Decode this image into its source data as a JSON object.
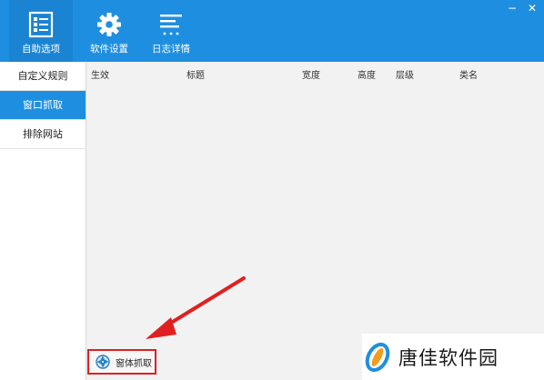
{
  "window": {
    "minimize_glyph": "−",
    "close_glyph": "✕"
  },
  "toolbar": {
    "items": [
      {
        "label": "自助选项",
        "icon": "checklist-icon",
        "active": true
      },
      {
        "label": "软件设置",
        "icon": "gear-icon",
        "active": false
      },
      {
        "label": "日志详情",
        "icon": "log-lines-icon",
        "active": false
      }
    ]
  },
  "sidebar": {
    "items": [
      {
        "label": "自定义规则",
        "active": false
      },
      {
        "label": "窗口抓取",
        "active": true
      },
      {
        "label": "排除网站",
        "active": false
      }
    ]
  },
  "table": {
    "columns": [
      "生效",
      "标题",
      "宽度",
      "高度",
      "层级",
      "类名"
    ]
  },
  "grab_button": {
    "label": "窗体抓取",
    "icon": "aperture-icon"
  },
  "watermark": {
    "text": "唐佳软件园"
  },
  "colors": {
    "accent": "#1e8fe0",
    "highlight_red": "#e02020"
  }
}
